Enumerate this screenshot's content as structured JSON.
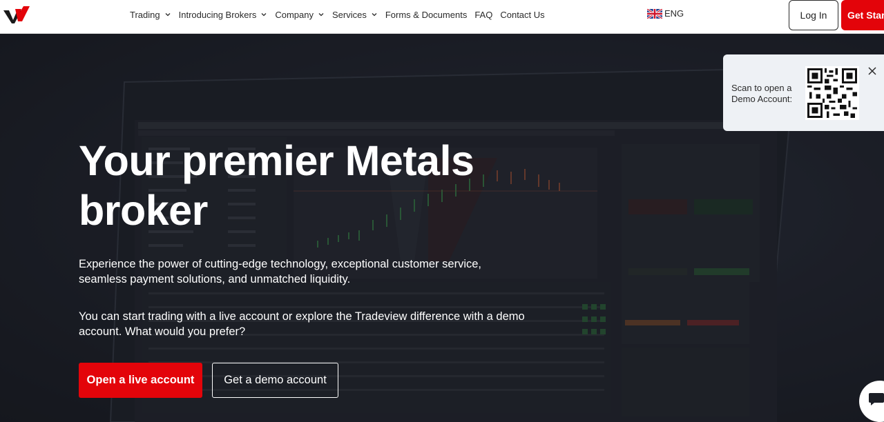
{
  "header": {
    "nav": [
      {
        "label": "Trading",
        "has_dropdown": true
      },
      {
        "label": "Introducing Brokers",
        "has_dropdown": true
      },
      {
        "label": "Company",
        "has_dropdown": true
      },
      {
        "label": "Services",
        "has_dropdown": true
      },
      {
        "label": "Forms & Documents",
        "has_dropdown": false
      },
      {
        "label": "FAQ",
        "has_dropdown": false
      },
      {
        "label": "Contact Us",
        "has_dropdown": false
      }
    ],
    "language": {
      "label": "ENG",
      "icon": "uk-flag-icon"
    },
    "login_label": "Log In",
    "start_label": "Get Start"
  },
  "hero": {
    "title": "Your premier Metals broker",
    "paragraph_1": "Experience the power of cutting-edge technology, exceptional customer service, seamless payment solutions, and unmatched liquidity.",
    "paragraph_2": "You can start trading with a live account or explore the Tradeview difference with a demo account. What would you prefer?",
    "live_button": "Open a live account",
    "demo_button": "Get a demo account"
  },
  "qr_popup": {
    "text": "Scan to open a Demo Account:",
    "icon": "qr-code-icon",
    "close_icon": "close-icon"
  },
  "chat": {
    "icon": "chat-icon"
  },
  "colors": {
    "brand_red": "#e3040a",
    "hero_bg": "#1b1e26",
    "white": "#ffffff"
  }
}
